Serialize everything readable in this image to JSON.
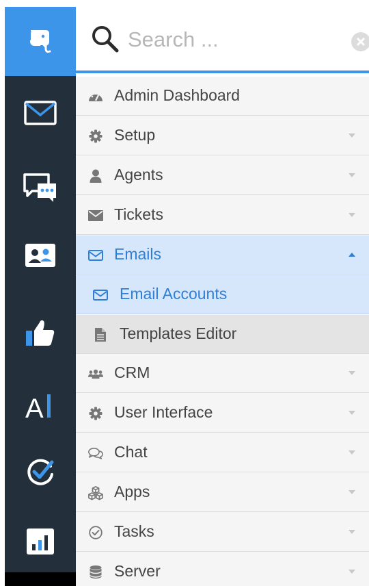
{
  "colors": {
    "rail_background": "#232f3b",
    "logo_background": "#3c95e8",
    "accent": "#3c95e8",
    "active_background": "#d6e6fb",
    "active_text": "#2f7fd6",
    "menu_background": "#f5f5f5",
    "submenu_background": "#e4e4e4"
  },
  "rail": {
    "logo_icon": "elephant-logo-icon",
    "items": [
      {
        "icon": "envelope-icon"
      },
      {
        "icon": "chat-bubbles-icon"
      },
      {
        "icon": "contact-card-icon"
      },
      {
        "icon": "thumbs-up-icon"
      },
      {
        "icon": "text-cursor-icon"
      },
      {
        "icon": "check-circle-icon"
      },
      {
        "icon": "bar-chart-icon"
      }
    ]
  },
  "search": {
    "placeholder": "Search ...",
    "value": ""
  },
  "menu": {
    "items": [
      {
        "label": "Admin Dashboard",
        "icon": "dashboard-icon",
        "expandable": false
      },
      {
        "label": "Setup",
        "icon": "gear-icon",
        "expandable": true
      },
      {
        "label": "Agents",
        "icon": "user-icon",
        "expandable": true
      },
      {
        "label": "Tickets",
        "icon": "envelope-icon",
        "expandable": true
      },
      {
        "label": "Emails",
        "icon": "envelope-outline-icon",
        "expandable": true,
        "expanded": true,
        "active": true,
        "children": [
          {
            "label": "Email Accounts",
            "icon": "envelope-outline-icon",
            "active": true
          },
          {
            "label": "Templates Editor",
            "icon": "file-icon",
            "active": false
          }
        ]
      },
      {
        "label": "CRM",
        "icon": "users-icon",
        "expandable": true
      },
      {
        "label": "User Interface",
        "icon": "gear-icon",
        "expandable": true
      },
      {
        "label": "Chat",
        "icon": "comments-icon",
        "expandable": true
      },
      {
        "label": "Apps",
        "icon": "cubes-icon",
        "expandable": true
      },
      {
        "label": "Tasks",
        "icon": "check-circle-icon",
        "expandable": true
      },
      {
        "label": "Server",
        "icon": "database-icon",
        "expandable": true
      }
    ]
  }
}
